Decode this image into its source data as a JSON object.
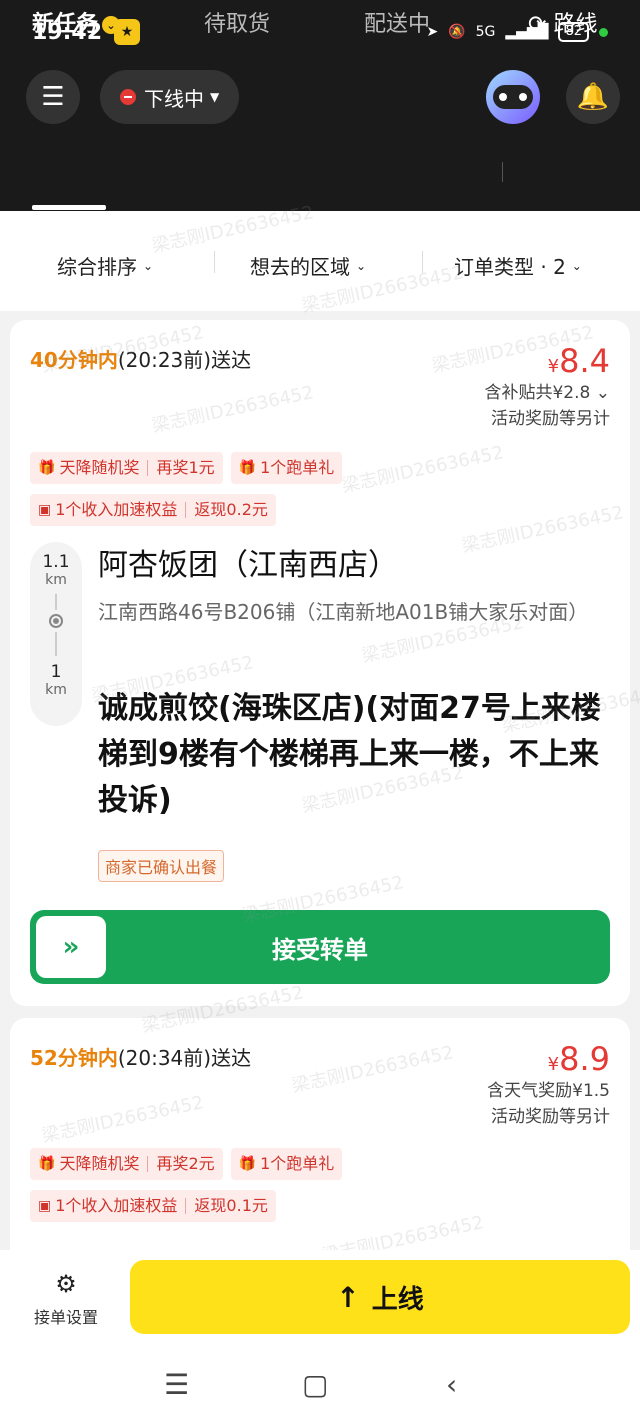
{
  "status_bar": {
    "time": "19:42",
    "network": "5G",
    "battery": "82"
  },
  "header": {
    "menu_icon": "menu-icon",
    "online_status": "下线中",
    "tabs": [
      {
        "label": "新任务",
        "active": true
      },
      {
        "label": "待取货",
        "active": false
      },
      {
        "label": "配送中",
        "active": false
      }
    ],
    "route_label": "路线"
  },
  "filters": {
    "sort": "综合排序",
    "region": "想去的区域",
    "order_type": "订单类型 · 2"
  },
  "orders": [
    {
      "time_highlight": "40分钟内",
      "time_rest": "(20:23前)送达",
      "price_symbol": "¥",
      "price": "8.4",
      "subsidy": "含补贴共¥2.8",
      "extra": "活动奖励等另计",
      "tags_row1": [
        {
          "a": "天降随机奖",
          "b": "再奖1元"
        },
        {
          "a": "1个跑单礼",
          "b": ""
        }
      ],
      "tags_row2": [
        {
          "a": "1个收入加速权益",
          "b": "返现0.2元"
        }
      ],
      "dist_pickup": "1.1",
      "dist_pickup_unit": "km",
      "dist_dest": "1",
      "dist_dest_unit": "km",
      "shop_name": "阿杏饭团（江南西店）",
      "shop_address": "江南西路46号B206铺（江南新地A01B铺大家乐对面）",
      "destination": "诚成煎饺(海珠区店)(对面27号上来楼梯到9楼有个楼梯再上来一楼，不上来投诉)",
      "merchant_status": "商家已确认出餐",
      "accept_label": "接受转单"
    },
    {
      "time_highlight": "52分钟内",
      "time_rest": "(20:34前)送达",
      "price_symbol": "¥",
      "price": "8.9",
      "subsidy": "含天气奖励¥1.5",
      "extra": "活动奖励等另计",
      "tags_row1": [
        {
          "a": "天降随机奖",
          "b": "再奖2元"
        },
        {
          "a": "1个跑单礼",
          "b": ""
        }
      ],
      "tags_row2": [
        {
          "a": "1个收入加速权益",
          "b": "返现0.1元"
        }
      ]
    }
  ],
  "watermark": "梁志刚ID26636452",
  "bottom": {
    "settings_label": "接单设置",
    "online_label": "上线"
  }
}
